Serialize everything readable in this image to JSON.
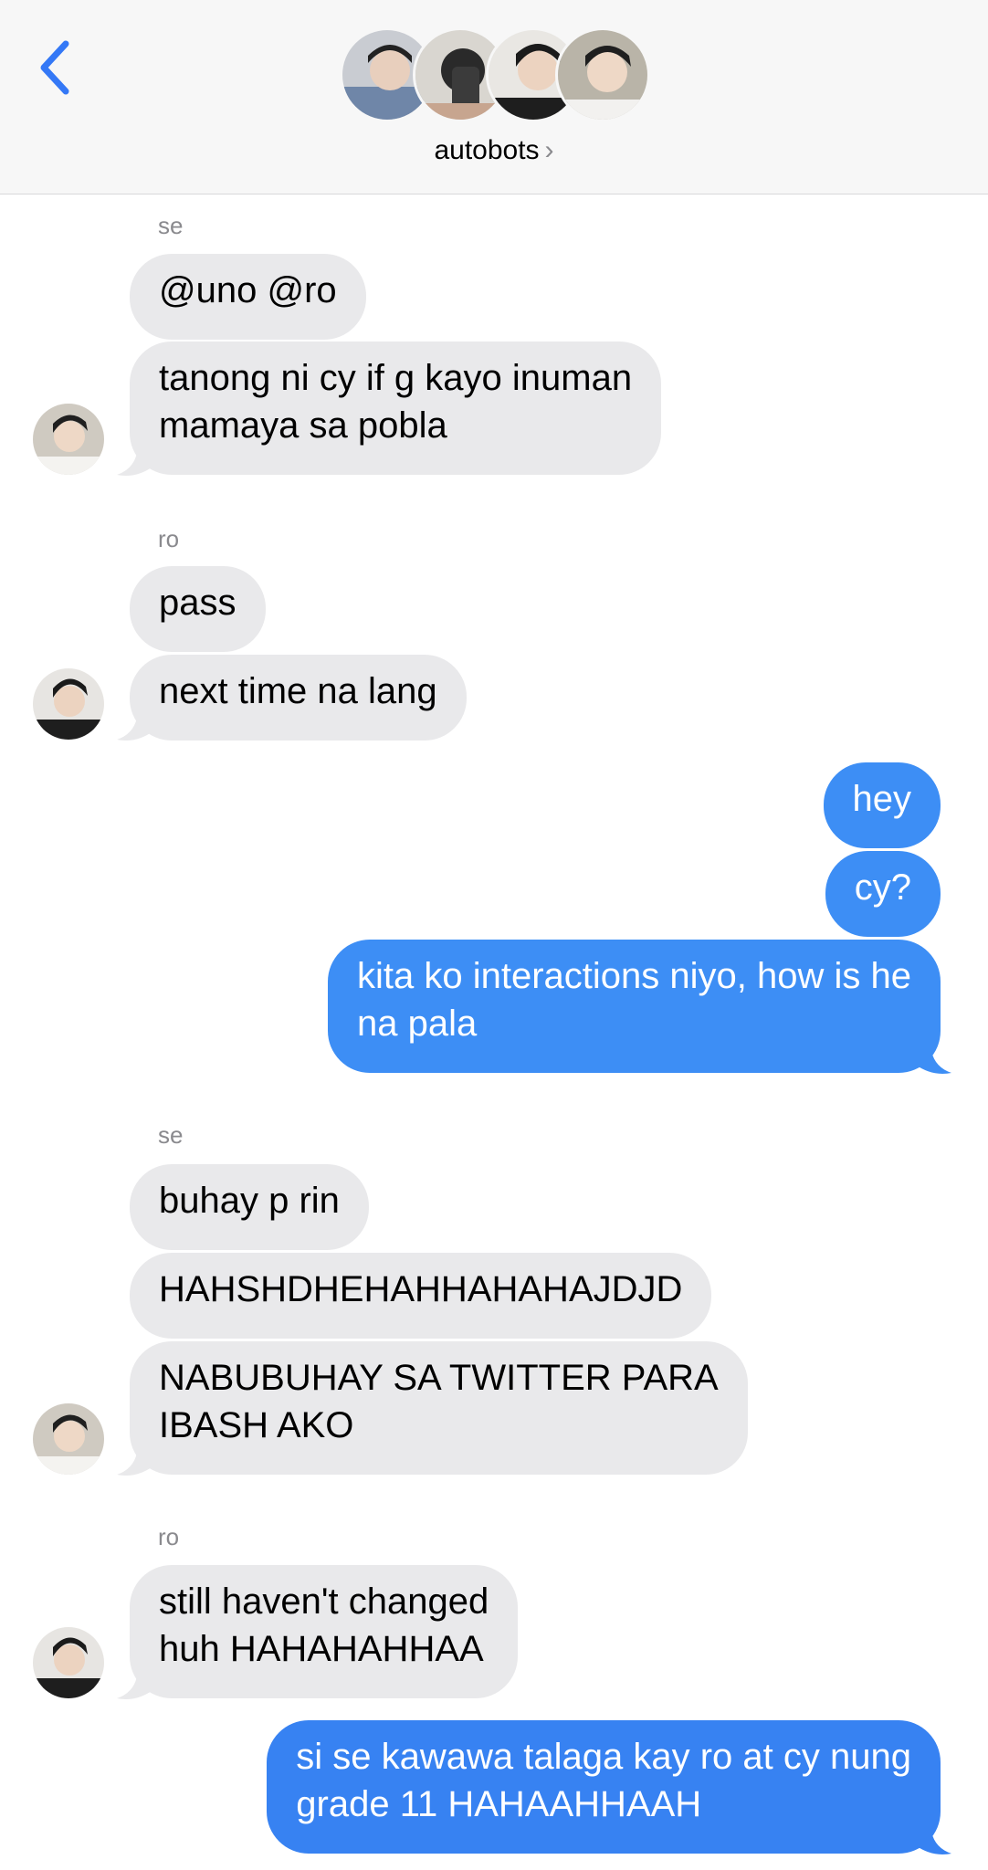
{
  "header": {
    "group_name": "autobots",
    "chevron": "›",
    "back_icon": "chevron-left-icon",
    "accent": "#3478f6"
  },
  "colors": {
    "incoming_bubble": "#e9e9eb",
    "outgoing_bubble": "#3d8ef5",
    "sender_label": "#8a8a8e"
  },
  "messages": [
    {
      "sender": "se"
    },
    {
      "text": "@uno @ro"
    },
    {
      "text": "tanong ni cy if g kayo inuman",
      "text2": "mamaya sa pobla"
    },
    {
      "sender": "ro"
    },
    {
      "text": "pass"
    },
    {
      "text": "next time na lang"
    },
    {
      "text": "hey"
    },
    {
      "text": "cy?"
    },
    {
      "text": "kita ko interactions niyo, how is he",
      "text2": "na pala"
    },
    {
      "sender": "se"
    },
    {
      "text": "buhay p rin"
    },
    {
      "text": "HAHSHDHEHAHHAHAHAJDJD"
    },
    {
      "text": "NABUBUHAY SA TWITTER PARA",
      "text2": "IBASH AKO"
    },
    {
      "sender": "ro"
    },
    {
      "text": "still haven't changed",
      "text2": "huh HAHAHAHHAA"
    },
    {
      "text": "si se kawawa talaga kay ro at cy nung",
      "text2": "grade 11 HAHAAHHAAH"
    }
  ]
}
